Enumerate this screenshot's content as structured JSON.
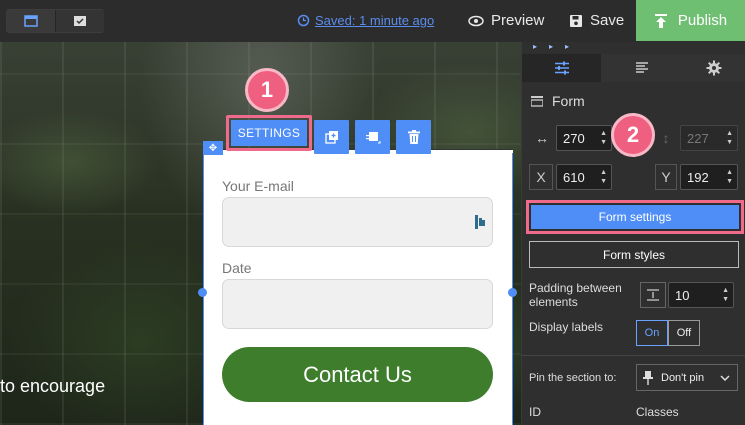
{
  "topbar": {
    "saved_text": "Saved: 1 minute ago",
    "preview_label": "Preview",
    "save_label": "Save",
    "publish_label": "Publish",
    "accent_color": "#6fbf73",
    "link_color": "#5a8dee"
  },
  "canvas": {
    "background_text": "to encourage",
    "toolbar": {
      "settings_label": "SETTINGS"
    },
    "callouts": [
      "1",
      "2"
    ],
    "form": {
      "email_label": "Your E-mail",
      "date_label": "Date",
      "button_label": "Contact Us",
      "button_color": "#3d7d2c"
    }
  },
  "panel": {
    "title": "Form",
    "width_value": "270",
    "height_value": "227",
    "x_label": "X",
    "x_value": "610",
    "y_label": "Y",
    "y_value": "192",
    "form_settings_label": "Form settings",
    "form_styles_label": "Form styles",
    "padding_label": "Padding between elements",
    "padding_value": "10",
    "display_labels_label": "Display labels",
    "on_label": "On",
    "off_label": "Off",
    "pin_label": "Pin the section to:",
    "pin_value": "Don't pin",
    "id_label": "ID",
    "classes_label": "Classes",
    "highlight_color": "#f06a8c"
  }
}
